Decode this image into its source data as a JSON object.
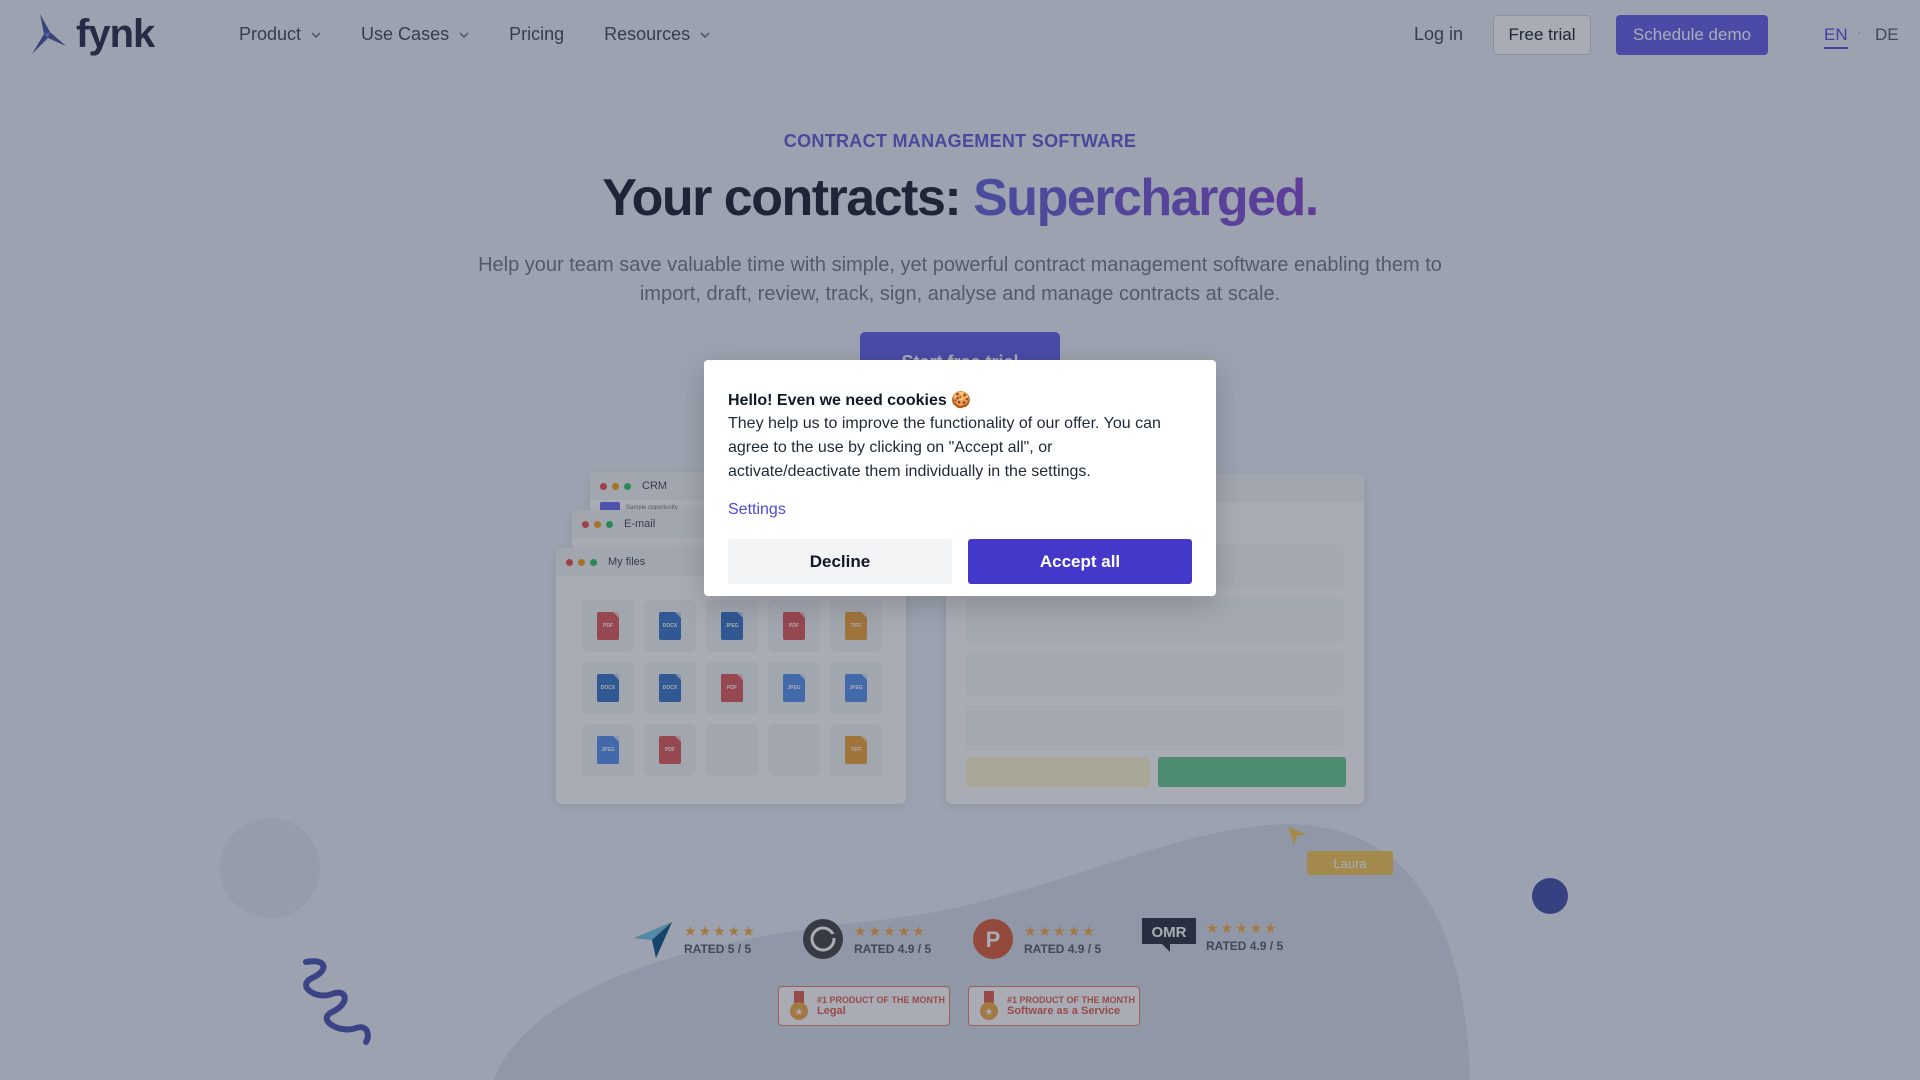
{
  "nav": {
    "logo_text": "fynk",
    "items": [
      {
        "label": "Product",
        "has_dropdown": true
      },
      {
        "label": "Use Cases",
        "has_dropdown": true
      },
      {
        "label": "Pricing",
        "has_dropdown": false
      },
      {
        "label": "Resources",
        "has_dropdown": true
      }
    ],
    "login": "Log in",
    "free_trial": "Free trial",
    "schedule_demo": "Schedule demo",
    "lang_en": "EN",
    "lang_sep": "·",
    "lang_de": "DE"
  },
  "hero": {
    "eyebrow": "CONTRACT MANAGEMENT SOFTWARE",
    "headline_main": "Your contracts: ",
    "headline_accent": "Supercharged.",
    "subtitle": "Help your team save valuable time with simple, yet powerful contract management software enabling them to import, draft, review, track, sign, analyse and manage contracts at scale.",
    "cta": "Start free trial"
  },
  "illustration": {
    "windows": [
      "CRM",
      "E-mail",
      "My files"
    ],
    "crm_item": "Sample opportunity",
    "file_rows": [
      [
        "PDF",
        "DOCX",
        "JPEG",
        "PDF",
        "TIFF"
      ],
      [
        "DOCX",
        "DOCX",
        "PDF",
        "JPEG",
        "JPEG"
      ],
      [
        "JPEG",
        "PDF",
        "",
        "",
        "TIFF"
      ]
    ],
    "cursor_label": "Laura"
  },
  "ratings": [
    {
      "icon": "capterra-icon",
      "stars": 5,
      "text": "RATED 5 / 5"
    },
    {
      "icon": "g2-icon",
      "stars": 5,
      "text": "RATED 4.9 / 5"
    },
    {
      "icon": "producthunt-icon",
      "stars": 5,
      "text": "RATED 4.9 / 5"
    },
    {
      "icon": "omr-icon",
      "stars": 5,
      "text": "RATED 4.9 / 5"
    }
  ],
  "ratings_logos": {
    "omr": "OMR",
    "producthunt": "P"
  },
  "awards": [
    {
      "small": "#1 PRODUCT OF THE MONTH",
      "big": "Legal"
    },
    {
      "small": "#1 PRODUCT OF THE MONTH",
      "big": "Software as a Service"
    }
  ],
  "cookie": {
    "title": "Hello! Even we need cookies 🍪",
    "body": "They help us to improve the functionality of our offer. You can agree to the use by clicking on \"Accept all\", or activate/deactivate them individually in the settings.",
    "settings": "Settings",
    "decline": "Decline",
    "accept": "Accept all"
  },
  "colors": {
    "accent": "#5b58e8",
    "overlay": "#31394d",
    "accept_button": "#4338ca"
  }
}
